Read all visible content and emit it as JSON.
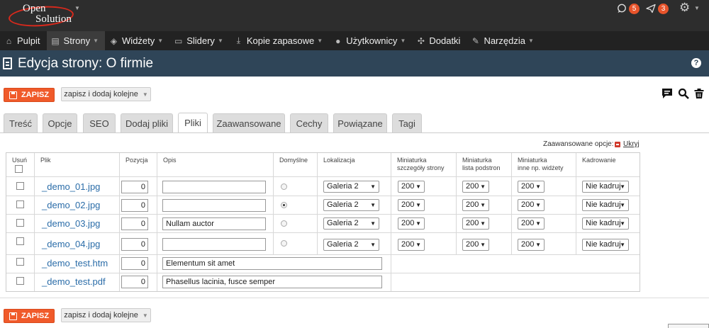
{
  "logo": {
    "line1": "Open",
    "line2": "Solution"
  },
  "notifications": {
    "comments_count": "5",
    "announcements_count": "3"
  },
  "nav": [
    {
      "label": "Pulpit",
      "icon": "home-icon"
    },
    {
      "label": "Strony",
      "icon": "document-icon",
      "caret": "▼"
    },
    {
      "label": "Widżety",
      "icon": "cube-icon",
      "caret": "▼"
    },
    {
      "label": "Slidery",
      "icon": "slides-icon",
      "caret": "▼"
    },
    {
      "label": "Kopie zapasowe",
      "icon": "download-icon",
      "caret": "▼"
    },
    {
      "label": "Użytkownicy",
      "icon": "user-icon",
      "caret": "▼"
    },
    {
      "label": "Dodatki",
      "icon": "puzzle-icon"
    },
    {
      "label": "Narzędzia",
      "icon": "wrench-icon",
      "caret": "▼"
    }
  ],
  "page": {
    "title": "Edycja strony: O firmie"
  },
  "actions": {
    "save": "ZAPISZ",
    "save_and_add": "zapisz i dodaj kolejne"
  },
  "tabs": [
    "Treść",
    "Opcje",
    "SEO",
    "Dodaj pliki",
    "Pliki",
    "Zaawansowane",
    "Cechy",
    "Powiązane",
    "Tagi"
  ],
  "active_tab": "Pliki",
  "advanced": {
    "label": "Zaawansowane opcje:",
    "hide": "Ukryj"
  },
  "table": {
    "headers": {
      "delete": "Usuń",
      "file": "Plik",
      "position": "Pozycja",
      "description": "Opis",
      "default": "Domyślne",
      "location": "Lokalizacja",
      "thumb_details_1": "Miniaturka",
      "thumb_details_2": "szczegóły strony",
      "thumb_list_1": "Miniaturka",
      "thumb_list_2": "lista podstron",
      "thumb_other_1": "Miniaturka",
      "thumb_other_2": "inne np. widżety",
      "crop": "Kadrowanie"
    },
    "rows": [
      {
        "file": "_demo_01.jpg",
        "position": "0",
        "description": "",
        "location": "Galeria 2",
        "thumb_details": "200",
        "thumb_list": "200",
        "thumb_other": "200",
        "crop": "Nie kadruj",
        "default": false
      },
      {
        "file": "_demo_02.jpg",
        "position": "0",
        "description": "",
        "location": "Galeria 2",
        "thumb_details": "200",
        "thumb_list": "200",
        "thumb_other": "200",
        "crop": "Nie kadruj",
        "default": true
      },
      {
        "file": "_demo_03.jpg",
        "position": "0",
        "description": "Nullam auctor",
        "location": "Galeria 2",
        "thumb_details": "200",
        "thumb_list": "200",
        "thumb_other": "200",
        "crop": "Nie kadruj",
        "default": false
      },
      {
        "file": "_demo_04.jpg",
        "position": "0",
        "description": "",
        "location": "Galeria 2",
        "thumb_details": "200",
        "thumb_list": "200",
        "thumb_other": "200",
        "crop": "Nie kadruj",
        "default": false
      },
      {
        "file": "_demo_test.htm",
        "position": "0",
        "description": "Elementum sit amet"
      },
      {
        "file": "_demo_test.pdf",
        "position": "0",
        "description": "Phasellus lacinia, fusce semper"
      }
    ]
  },
  "colors": {
    "topbar": "#2d2d2d",
    "nav": "#222222",
    "header": "#2f4558",
    "save_button": "#f05a2a",
    "link": "#2a6ca8",
    "badge": "#e8542b"
  }
}
